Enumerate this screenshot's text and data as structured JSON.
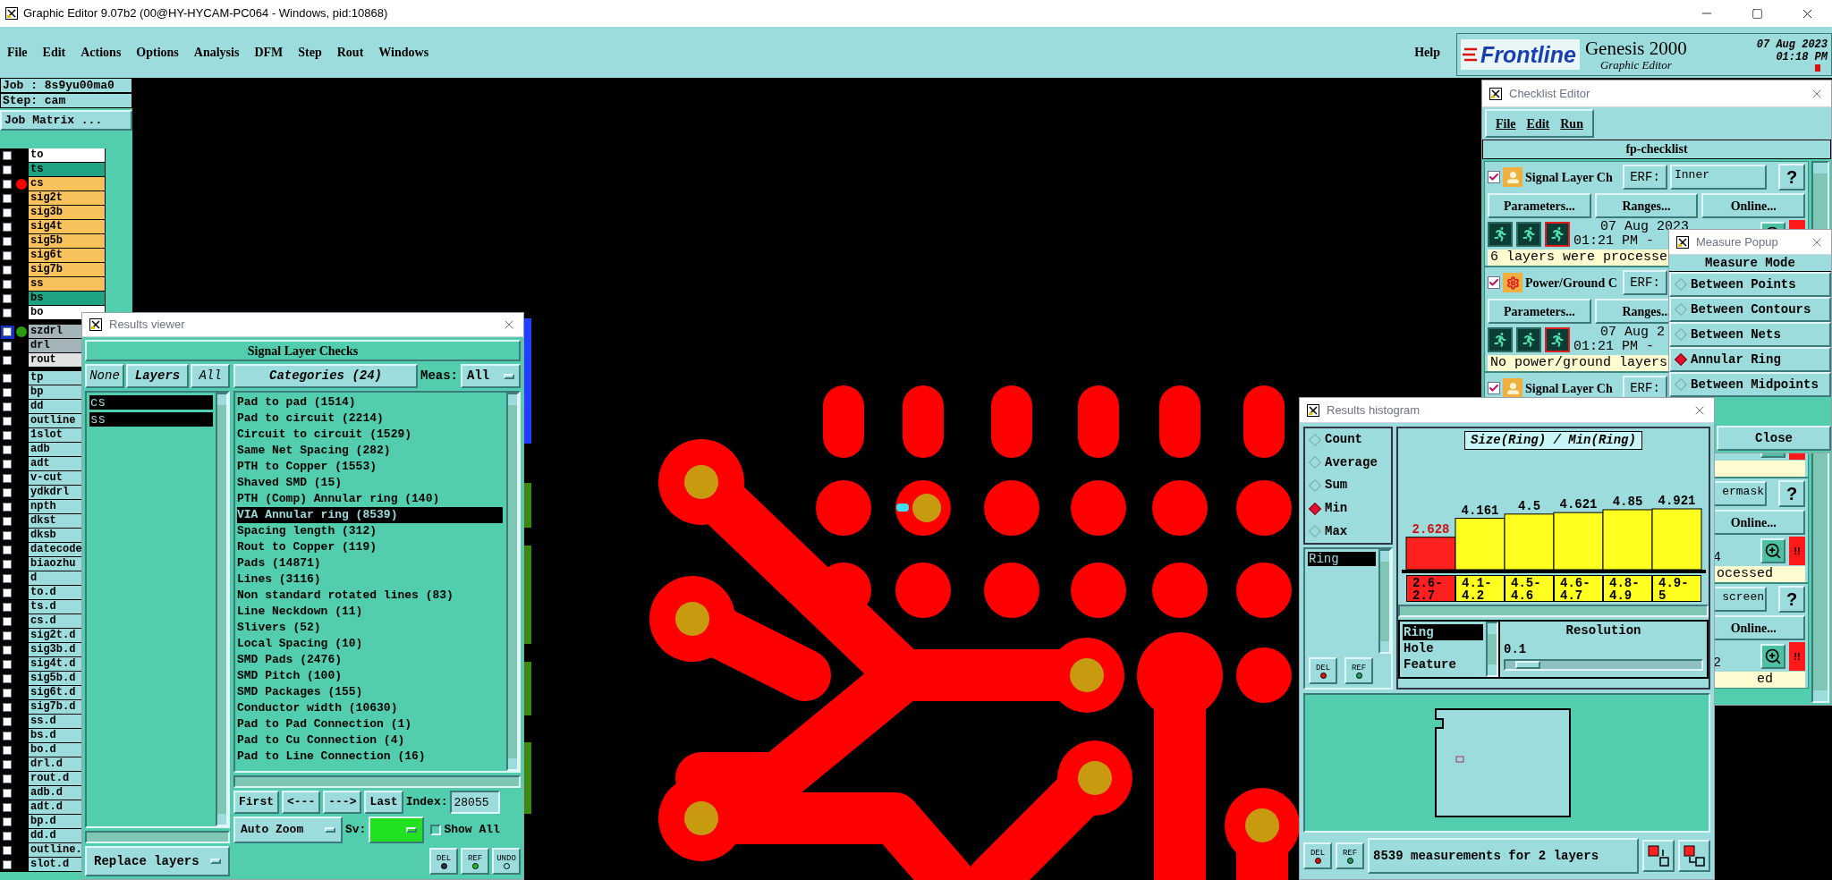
{
  "window": {
    "title": "Graphic Editor 9.07b2 (00@HY-HYCAM-PC064 - Windows, pid:10868)"
  },
  "menu": [
    "File",
    "Edit",
    "Actions",
    "Options",
    "Analysis",
    "DFM",
    "Step",
    "Rout",
    "Windows"
  ],
  "help": "Help",
  "brand": {
    "logo": "Frontline",
    "product": "Genesis 2000",
    "subtitle": "Graphic Editor",
    "date": "07 Aug 2023",
    "time": "01:18 PM"
  },
  "job_panel": {
    "job": "Job : 8s9yu00ma0",
    "step": "Step: cam",
    "matrix_button": "Job Matrix ...",
    "layer_groups": [
      [
        {
          "name": "to",
          "color": "#ffffff",
          "checked": false,
          "selected": false
        },
        {
          "name": "ts",
          "color": "#1fa383",
          "checked": false,
          "selected": false
        },
        {
          "name": "cs",
          "color": "#f7c15c",
          "checked": false,
          "selected": false,
          "dot": {
            "color": "#ff0000"
          }
        },
        {
          "name": "sig2t",
          "color": "#f7c15c",
          "checked": false,
          "selected": false
        },
        {
          "name": "sig3b",
          "color": "#f7c15c",
          "checked": false,
          "selected": false
        },
        {
          "name": "sig4t",
          "color": "#f7c15c",
          "checked": false,
          "selected": false
        },
        {
          "name": "sig5b",
          "color": "#f7c15c",
          "checked": false,
          "selected": false
        },
        {
          "name": "sig6t",
          "color": "#f7c15c",
          "checked": false,
          "selected": false
        },
        {
          "name": "sig7b",
          "color": "#f7c15c",
          "checked": false,
          "selected": false
        },
        {
          "name": "ss",
          "color": "#f7c15c",
          "checked": false,
          "selected": false
        },
        {
          "name": "bs",
          "color": "#1fa383",
          "checked": false,
          "selected": false
        },
        {
          "name": "bo",
          "color": "#ffffff",
          "checked": false,
          "selected": false
        }
      ],
      [
        {
          "name": "szdrl",
          "color": "#a3b5bb",
          "checked": false,
          "selected": true,
          "dot": {
            "color": "#2a9a10"
          }
        },
        {
          "name": "drl",
          "color": "#a3b5bb",
          "checked": false,
          "selected": false
        },
        {
          "name": "rout",
          "color": "#e2e2e2",
          "checked": false,
          "selected": false
        }
      ],
      [
        {
          "name": "tp",
          "color": "#9ddcdc",
          "checked": false,
          "selected": false
        },
        {
          "name": "bp",
          "color": "#9ddcdc",
          "checked": false,
          "selected": false
        },
        {
          "name": "dd",
          "color": "#9ddcdc",
          "checked": false,
          "selected": false
        },
        {
          "name": "outline",
          "color": "#9ddcdc",
          "checked": false,
          "selected": false
        },
        {
          "name": "1slot",
          "color": "#9ddcdc",
          "checked": false,
          "selected": false
        },
        {
          "name": "adb",
          "color": "#9ddcdc",
          "checked": false,
          "selected": false
        },
        {
          "name": "adt",
          "color": "#9ddcdc",
          "checked": false,
          "selected": false
        },
        {
          "name": "v-cut",
          "color": "#9ddcdc",
          "checked": false,
          "selected": false
        },
        {
          "name": "ydkdrl",
          "color": "#9ddcdc",
          "checked": false,
          "selected": false
        },
        {
          "name": "npth",
          "color": "#9ddcdc",
          "checked": false,
          "selected": false
        },
        {
          "name": "dkst",
          "color": "#9ddcdc",
          "checked": false,
          "selected": false
        },
        {
          "name": "dksb",
          "color": "#9ddcdc",
          "checked": false,
          "selected": false
        },
        {
          "name": "datecode",
          "color": "#9ddcdc",
          "checked": false,
          "selected": false
        },
        {
          "name": "biaozhu",
          "color": "#9ddcdc",
          "checked": false,
          "selected": false
        },
        {
          "name": "d",
          "color": "#9ddcdc",
          "checked": false,
          "selected": false
        },
        {
          "name": "to.d",
          "color": "#9ddcdc",
          "checked": false,
          "selected": false
        },
        {
          "name": "ts.d",
          "color": "#9ddcdc",
          "checked": false,
          "selected": false
        },
        {
          "name": "cs.d",
          "color": "#9ddcdc",
          "checked": false,
          "selected": false
        },
        {
          "name": "sig2t.d",
          "color": "#9ddcdc",
          "checked": false,
          "selected": false
        },
        {
          "name": "sig3b.d",
          "color": "#9ddcdc",
          "checked": false,
          "selected": false
        },
        {
          "name": "sig4t.d",
          "color": "#9ddcdc",
          "checked": false,
          "selected": false
        },
        {
          "name": "sig5b.d",
          "color": "#9ddcdc",
          "checked": false,
          "selected": false
        },
        {
          "name": "sig6t.d",
          "color": "#9ddcdc",
          "checked": false,
          "selected": false
        },
        {
          "name": "sig7b.d",
          "color": "#9ddcdc",
          "checked": false,
          "selected": false
        },
        {
          "name": "ss.d",
          "color": "#9ddcdc",
          "checked": false,
          "selected": false
        },
        {
          "name": "bs.d",
          "color": "#9ddcdc",
          "checked": false,
          "selected": false
        },
        {
          "name": "bo.d",
          "color": "#9ddcdc",
          "checked": false,
          "selected": false
        },
        {
          "name": "drl.d",
          "color": "#9ddcdc",
          "checked": false,
          "selected": false
        },
        {
          "name": "rout.d",
          "color": "#9ddcdc",
          "checked": false,
          "selected": false
        },
        {
          "name": "adb.d",
          "color": "#9ddcdc",
          "checked": false,
          "selected": false
        },
        {
          "name": "adt.d",
          "color": "#9ddcdc",
          "checked": false,
          "selected": false
        },
        {
          "name": "bp.d",
          "color": "#9ddcdc",
          "checked": false,
          "selected": false
        },
        {
          "name": "dd.d",
          "color": "#9ddcdc",
          "checked": false,
          "selected": false
        },
        {
          "name": "outline.",
          "color": "#9ddcdc",
          "checked": false,
          "selected": false
        },
        {
          "name": "slot.d",
          "color": "#9ddcdc",
          "checked": false,
          "selected": false
        }
      ]
    ]
  },
  "results_viewer": {
    "title": "Results viewer",
    "header": "Signal Layer Checks",
    "layer_filters": [
      "None",
      "Layers",
      "All"
    ],
    "layers": [
      {
        "name": "cs",
        "selected": true
      },
      {
        "name": "ss",
        "selected": true
      }
    ],
    "replace_mode": "Replace layers",
    "categories_button": "Categories (24)",
    "meas_label": "Meas:",
    "meas_value": "All",
    "categories": [
      {
        "label": "Pad to pad (1514)",
        "selected": false
      },
      {
        "label": "Pad to circuit (2214)",
        "selected": false
      },
      {
        "label": "Circuit to circuit (1529)",
        "selected": false
      },
      {
        "label": "Same Net Spacing (282)",
        "selected": false
      },
      {
        "label": "PTH to Copper (1553)",
        "selected": false
      },
      {
        "label": "Shaved SMD (15)",
        "selected": false
      },
      {
        "label": "PTH (Comp) Annular ring (140)",
        "selected": false
      },
      {
        "label": "VIA Annular ring (8539)",
        "selected": true
      },
      {
        "label": "Spacing length (312)",
        "selected": false
      },
      {
        "label": "Rout to Copper (119)",
        "selected": false
      },
      {
        "label": "Pads (14871)",
        "selected": false
      },
      {
        "label": "Lines (3116)",
        "selected": false
      },
      {
        "label": "Non standard rotated lines (83)",
        "selected": false
      },
      {
        "label": "Line Neckdown (11)",
        "selected": false
      },
      {
        "label": "Slivers (52)",
        "selected": false
      },
      {
        "label": "Local Spacing (10)",
        "selected": false
      },
      {
        "label": "SMD Pads (2476)",
        "selected": false
      },
      {
        "label": "SMD Pitch (100)",
        "selected": false
      },
      {
        "label": "SMD Packages (155)",
        "selected": false
      },
      {
        "label": "Conductor width (10630)",
        "selected": false
      },
      {
        "label": "Pad to Pad Connection (1)",
        "selected": false
      },
      {
        "label": "Pad to Cu Connection (4)",
        "selected": false
      },
      {
        "label": "Pad to Line Connection (16)",
        "selected": false
      }
    ],
    "nav": [
      "First",
      "<---",
      "--->",
      "Last"
    ],
    "index_label": "Index:",
    "index_value": "28055",
    "zoom_mode": "Auto Zoom",
    "sv_label": "Sv:",
    "show_all": {
      "label": "Show All",
      "checked": false
    },
    "tool_buttons": [
      "DEL",
      "REF",
      "UNDO"
    ]
  },
  "checklist": {
    "title": "Checklist Editor",
    "menu": [
      "File",
      "Edit",
      "Run"
    ],
    "name": "fp-checklist",
    "checks": [
      {
        "kind": "full",
        "checked": true,
        "name": "Signal Layer Ch",
        "erf_label": "ERF:",
        "erf_value": "Inner",
        "help": "?",
        "parameters": "Parameters...",
        "ranges": "Ranges...",
        "online": "Online...",
        "date": "07 Aug 2023",
        "time": "01:21 PM -",
        "status": "6 layers were processe"
      },
      {
        "kind": "full",
        "checked": true,
        "name": "Power/Ground C",
        "erf_label": "ERF:",
        "parameters": "Parameters...",
        "ranges": "Ranges...",
        "date": "07 Aug 2",
        "time": "01:21 PM -",
        "status": "No power/ground layers"
      },
      {
        "kind": "full",
        "checked": true,
        "name": "Signal Layer Ch",
        "erf_label": "ERF:"
      },
      {
        "kind": "clipped",
        "erf_value": "ermask",
        "help": "?",
        "online": "Online...",
        "time": "4",
        "alert": "!!",
        "status": "ocessed"
      },
      {
        "kind": "clipped",
        "erf_value": "screen",
        "help": "?",
        "online": "Online...",
        "time": "2",
        "alert": "!!",
        "status": "ed"
      }
    ]
  },
  "measure_popup": {
    "title": "Measure Popup",
    "heading": "Measure Mode",
    "modes": [
      {
        "label": "Between Points",
        "selected": false
      },
      {
        "label": "Between Contours",
        "selected": false
      },
      {
        "label": "Between Nets",
        "selected": false
      },
      {
        "label": "Annular Ring",
        "selected": true
      },
      {
        "label": "Between Midpoints",
        "selected": false
      }
    ],
    "close": "Close"
  },
  "histogram": {
    "title": "Results histogram",
    "functions": [
      {
        "label": "Count",
        "selected": false
      },
      {
        "label": "Average",
        "selected": false
      },
      {
        "label": "Sum",
        "selected": false
      },
      {
        "label": "Min",
        "selected": true
      },
      {
        "label": "Max",
        "selected": false
      }
    ],
    "measures": [
      {
        "label": "Ring",
        "selected": true
      }
    ],
    "list_buttons": [
      "DEL",
      "REF"
    ],
    "chart_data": {
      "type": "bar",
      "title": "Size(Ring) / Min(Ring)",
      "categories": [
        "2.6-2.7",
        "4.1-4.2",
        "4.5-4.6",
        "4.6-4.7",
        "4.8-4.9",
        "4.9-5"
      ],
      "series": [
        {
          "color": "#ff2020",
          "values": [
            2.628,
            null,
            null,
            null,
            null,
            null
          ]
        },
        {
          "color": "#ffff20",
          "values": [
            null,
            4.161,
            4.5,
            4.621,
            4.85,
            4.921
          ]
        }
      ],
      "data_labels": true
    },
    "attributes": [
      {
        "label": "Ring",
        "selected": true
      },
      {
        "label": "Hole",
        "selected": false
      },
      {
        "label": "Feature",
        "selected": false
      }
    ],
    "resolution": {
      "label": "Resolution",
      "value": "0.1",
      "level": 0.05
    },
    "bottom_buttons": [
      "DEL",
      "REF"
    ],
    "status": "8539 measurements for 2 layers"
  }
}
